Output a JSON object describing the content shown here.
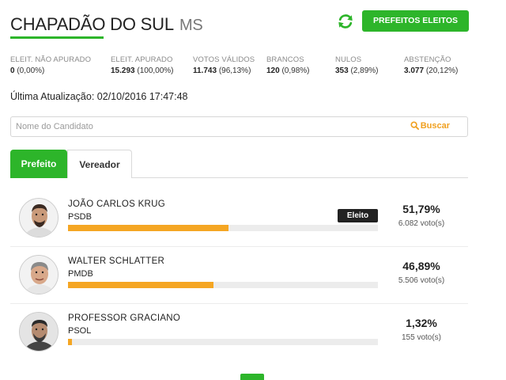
{
  "header": {
    "city": "CHAPADÃO DO SUL",
    "state": "MS",
    "eleitos_button": "PREFEITOS ELEITOS",
    "accent_color": "#2db52a"
  },
  "stats": [
    {
      "label": "ELEIT. NÃO APURADO",
      "value": "0",
      "pct": "(0,00%)"
    },
    {
      "label": "ELEIT. APURADO",
      "value": "15.293",
      "pct": "(100,00%)"
    },
    {
      "label": "VOTOS VÁLIDOS",
      "value": "11.743",
      "pct": "(96,13%)"
    },
    {
      "label": "BRANCOS",
      "value": "120",
      "pct": "(0,98%)"
    },
    {
      "label": "NULOS",
      "value": "353",
      "pct": "(2,89%)"
    },
    {
      "label": "ABSTENÇÃO",
      "value": "3.077",
      "pct": "(20,12%)"
    }
  ],
  "updated": {
    "label": "Última Atualização:",
    "value": "02/10/2016 17:47:48"
  },
  "search": {
    "placeholder": "Nome do Candidato",
    "button": "Buscar"
  },
  "tabs": [
    "Prefeito",
    "Vereador"
  ],
  "candidates": [
    {
      "name": "JOÃO CARLOS KRUG",
      "party": "PSDB",
      "pct": "51,79%",
      "votes": "6.082 voto(s)",
      "bar_fraction": 0.5179,
      "badge": "Eleito"
    },
    {
      "name": "WALTER SCHLATTER",
      "party": "PMDB",
      "pct": "46,89%",
      "votes": "5.506 voto(s)",
      "bar_fraction": 0.4689
    },
    {
      "name": "PROFESSOR GRACIANO",
      "party": "PSOL",
      "pct": "1,32%",
      "votes": "155 voto(s)",
      "bar_fraction": 0.0132
    }
  ],
  "bar_color": "#f5a623"
}
